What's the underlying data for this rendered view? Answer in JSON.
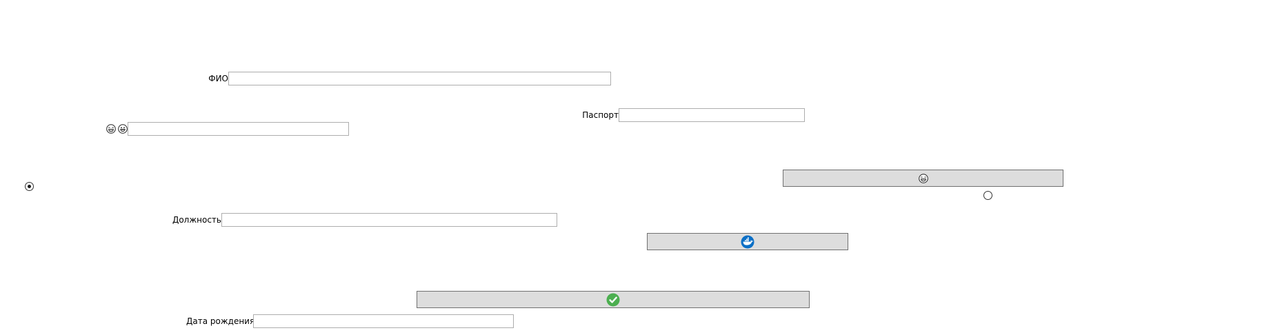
{
  "form": {
    "fio": {
      "label": "ФИО",
      "value": ""
    },
    "passport": {
      "label": "Паспорт",
      "value": ""
    },
    "emoji_field": {
      "icons": [
        "laughing-emoji-icon",
        "grinning-emoji-icon"
      ],
      "value": ""
    },
    "position": {
      "label": "Должность",
      "value": ""
    },
    "birth_date": {
      "label": "Дата рождения",
      "value": ""
    }
  },
  "buttons": {
    "emoji_button": {
      "icon": "laughing-emoji-icon"
    },
    "docker_button": {
      "icon": "docker-whale-icon",
      "color": "#0b6fc6"
    },
    "confirm_button": {
      "icon": "green-checkmark-icon",
      "color": "#4caf50"
    }
  },
  "radios": {
    "left_radio": {
      "checked": true
    },
    "right_radio": {
      "checked": false
    }
  }
}
